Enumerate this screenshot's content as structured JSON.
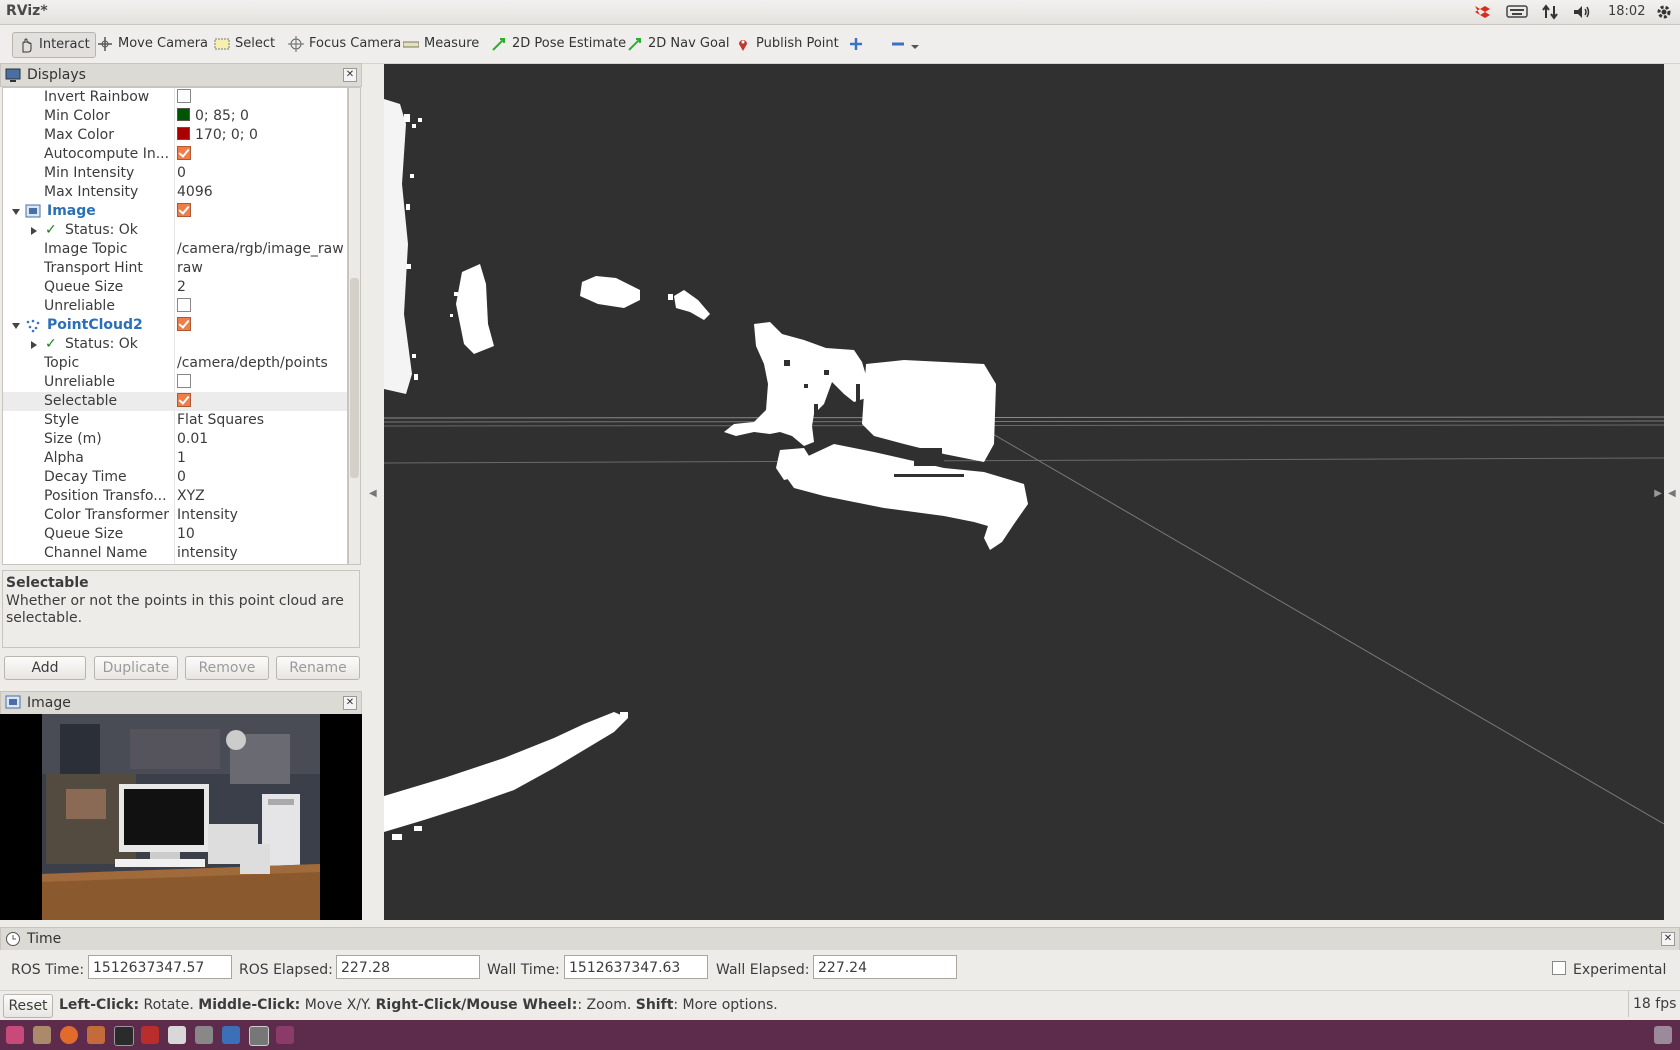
{
  "window": {
    "title": "RViz*"
  },
  "tray": {
    "clock": "18:02"
  },
  "toolbar": {
    "interact": "Interact",
    "move_camera": "Move Camera",
    "select": "Select",
    "focus_camera": "Focus Camera",
    "measure": "Measure",
    "pose_estimate": "2D Pose Estimate",
    "nav_goal": "2D Nav Goal",
    "publish_point": "Publish Point"
  },
  "displays": {
    "title": "Displays",
    "rows": {
      "invert_rainbow": "Invert Rainbow",
      "min_color": {
        "label": "Min Color",
        "value": "0; 85; 0",
        "color": "#005500"
      },
      "max_color": {
        "label": "Max Color",
        "value": "170; 0; 0",
        "color": "#aa0000"
      },
      "autocompute": "Autocompute In...",
      "min_intensity": {
        "label": "Min Intensity",
        "value": "0"
      },
      "max_intensity": {
        "label": "Max Intensity",
        "value": "4096"
      },
      "image": "Image",
      "image_status": "Status: Ok",
      "image_topic": {
        "label": "Image Topic",
        "value": "/camera/rgb/image_raw"
      },
      "transport_hint": {
        "label": "Transport Hint",
        "value": "raw"
      },
      "queue_size": {
        "label": "Queue Size",
        "value": "2"
      },
      "unreliable": "Unreliable",
      "pointcloud": "PointCloud2",
      "pc_status": "Status: Ok",
      "topic": {
        "label": "Topic",
        "value": "/camera/depth/points"
      },
      "pc_unreliable": "Unreliable",
      "selectable": "Selectable",
      "style": {
        "label": "Style",
        "value": "Flat Squares"
      },
      "size": {
        "label": "Size (m)",
        "value": "0.01"
      },
      "alpha": {
        "label": "Alpha",
        "value": "1"
      },
      "decay": {
        "label": "Decay Time",
        "value": "0"
      },
      "position_transformer": {
        "label": "Position Transfo...",
        "value": "XYZ"
      },
      "color_transformer": {
        "label": "Color Transformer",
        "value": "Intensity"
      },
      "pc_queue": {
        "label": "Queue Size",
        "value": "10"
      },
      "channel": {
        "label": "Channel Name",
        "value": "intensity"
      }
    },
    "help_title": "Selectable",
    "help_text": "Whether or not the points in this point cloud are selectable.",
    "buttons": {
      "add": "Add",
      "duplicate": "Duplicate",
      "remove": "Remove",
      "rename": "Rename"
    }
  },
  "image_panel": {
    "title": "Image"
  },
  "time_panel": {
    "title": "Time",
    "ros_time_label": "ROS Time:",
    "ros_time": "1512637347.57",
    "ros_elapsed_label": "ROS Elapsed:",
    "ros_elapsed": "227.28",
    "wall_time_label": "Wall Time:",
    "wall_time": "1512637347.63",
    "wall_elapsed_label": "Wall Elapsed:",
    "wall_elapsed": "227.24",
    "experimental": "Experimental"
  },
  "status": {
    "reset": "Reset",
    "lc": "Left-Click:",
    "lc_t": " Rotate. ",
    "mc": "Middle-Click:",
    "mc_t": " Move X/Y. ",
    "rc": "Right-Click/Mouse Wheel:",
    "rc_t": ": Zoom. ",
    "sh": "Shift",
    "sh_t": ": More options.",
    "fps": "18 fps"
  }
}
